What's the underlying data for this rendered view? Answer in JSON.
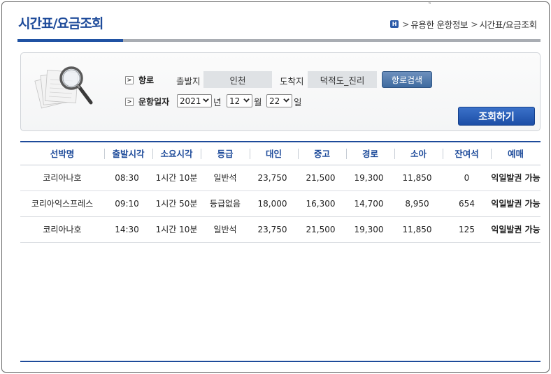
{
  "header": {
    "title": "시간표/요금조회",
    "breadcrumb": [
      "유용한 운항정보",
      "시간표/요금조회"
    ],
    "home_icon_glyph": "H",
    "separator": ">"
  },
  "search": {
    "route_label": "항로",
    "departure_label": "출발지",
    "departure_value": "인천",
    "arrival_label": "도착지",
    "arrival_value": "덕적도_진리",
    "route_search_button": "항로검색",
    "date_label": "운항일자",
    "year": "2021",
    "year_unit": "년",
    "month": "12",
    "month_unit": "월",
    "day": "22",
    "day_unit": "일",
    "query_button": "조회하기"
  },
  "table": {
    "headers": [
      "선박명",
      "출발시각",
      "소요시각",
      "등급",
      "대인",
      "중고",
      "경로",
      "소아",
      "잔여석",
      "예매"
    ],
    "rows": [
      {
        "ship": "코리아나호",
        "depart": "08:30",
        "duration": "1시간 10분",
        "grade": "일반석",
        "adult": "23,750",
        "student": "21,500",
        "senior": "19,300",
        "child": "11,850",
        "seats": "0",
        "status": "익일발권 가능"
      },
      {
        "ship": "코리아익스프레스",
        "depart": "09:10",
        "duration": "1시간 50분",
        "grade": "등급없음",
        "adult": "18,000",
        "student": "16,300",
        "senior": "14,700",
        "child": "8,950",
        "seats": "654",
        "status": "익일발권 가능"
      },
      {
        "ship": "코리아나호",
        "depart": "14:30",
        "duration": "1시간 10분",
        "grade": "일반석",
        "adult": "23,750",
        "student": "21,500",
        "senior": "19,300",
        "child": "11,850",
        "seats": "125",
        "status": "익일발권 가능"
      }
    ]
  },
  "colors": {
    "brand_blue": "#1e4b9a",
    "status_red": "#d02020",
    "field_gray": "#dfe2e5"
  },
  "icons": {
    "magnifier": "magnifier-documents-icon",
    "arrow": "chevron-right-icon",
    "select_arrow": "chevron-down-icon"
  }
}
